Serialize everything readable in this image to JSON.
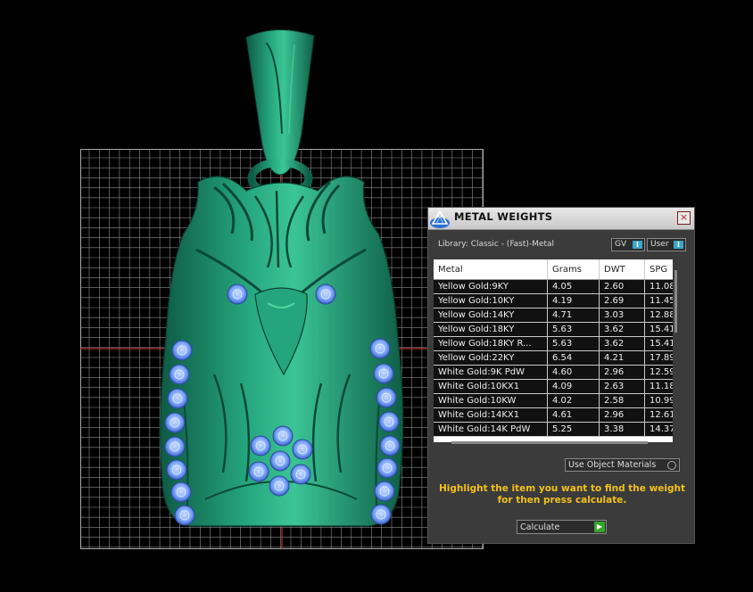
{
  "panel": {
    "title": "METAL WEIGHTS",
    "close_icon": "×",
    "library_label": "Library: Classic - (Fast)-Metal",
    "toggle_gv": {
      "label": "GV",
      "state_glyph": "I"
    },
    "toggle_user": {
      "label": "User",
      "state_glyph": "I"
    },
    "columns": [
      "Metal",
      "Grams",
      "DWT",
      "SPG"
    ],
    "rows": [
      [
        "Yellow Gold:9KY",
        "4.05",
        "2.60",
        "11.08"
      ],
      [
        "Yellow Gold:10KY",
        "4.19",
        "2.69",
        "11.45"
      ],
      [
        "Yellow Gold:14KY",
        "4.71",
        "3.03",
        "12.88"
      ],
      [
        "Yellow Gold:18KY",
        "5.63",
        "3.62",
        "15.41"
      ],
      [
        "Yellow Gold:18KY R...",
        "5.63",
        "3.62",
        "15.41"
      ],
      [
        "Yellow Gold:22KY",
        "6.54",
        "4.21",
        "17.89"
      ],
      [
        "White Gold:9K PdW",
        "4.60",
        "2.96",
        "12.59"
      ],
      [
        "White Gold:10KX1",
        "4.09",
        "2.63",
        "11.18"
      ],
      [
        "White Gold:10KW",
        "4.02",
        "2.58",
        "10.99"
      ],
      [
        "White Gold:14KX1",
        "4.61",
        "2.96",
        "12.61"
      ],
      [
        "White Gold:14K PdW",
        "5.25",
        "3.38",
        "14.37"
      ]
    ],
    "use_object_materials": "Use Object Materials",
    "hint": "Highlight the item you want to find the weight for then press calculate.",
    "calculate_label": "Calculate",
    "calculate_icon": "play-icon"
  },
  "colors": {
    "metal_green": "#1f9a73",
    "stone_blue": "#7ea8ff",
    "hint_yellow": "#f2c21a",
    "calc_green": "#37a42c"
  }
}
